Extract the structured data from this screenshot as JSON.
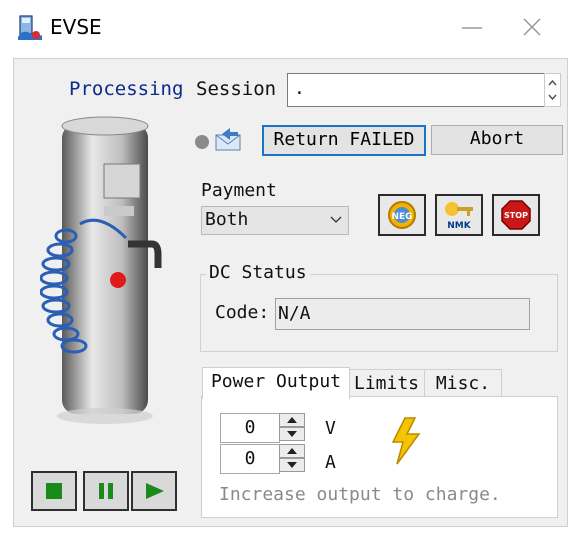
{
  "window": {
    "title": "EVSE",
    "icon": "evse-app-icon"
  },
  "session": {
    "status_label": "Processing",
    "label": "Session",
    "value": "."
  },
  "buttons": {
    "return": "Return FAILED",
    "abort": "Abort"
  },
  "payment": {
    "label": "Payment",
    "selected": "Both"
  },
  "icon_buttons": [
    {
      "name": "neg-icon",
      "text": "NEG"
    },
    {
      "name": "nmk-icon",
      "text": "NMK"
    },
    {
      "name": "stop-icon",
      "text": "STOP"
    }
  ],
  "dc_status": {
    "title": "DC Status",
    "code_label": "Code:",
    "code_value": "N/A"
  },
  "tabs": [
    {
      "label": "Power Output",
      "active": true
    },
    {
      "label": "Limits",
      "active": false
    },
    {
      "label": "Misc.",
      "active": false
    }
  ],
  "power_output": {
    "voltage": "0",
    "voltage_unit": "V",
    "current": "0",
    "current_unit": "A",
    "hint": "Increase output to charge."
  },
  "colors": {
    "accent": "#1a73c7",
    "processing": "#0b2a8a",
    "media_green": "#1a8a1a"
  },
  "media_controls": [
    "stop-icon",
    "pause-icon",
    "play-icon"
  ]
}
